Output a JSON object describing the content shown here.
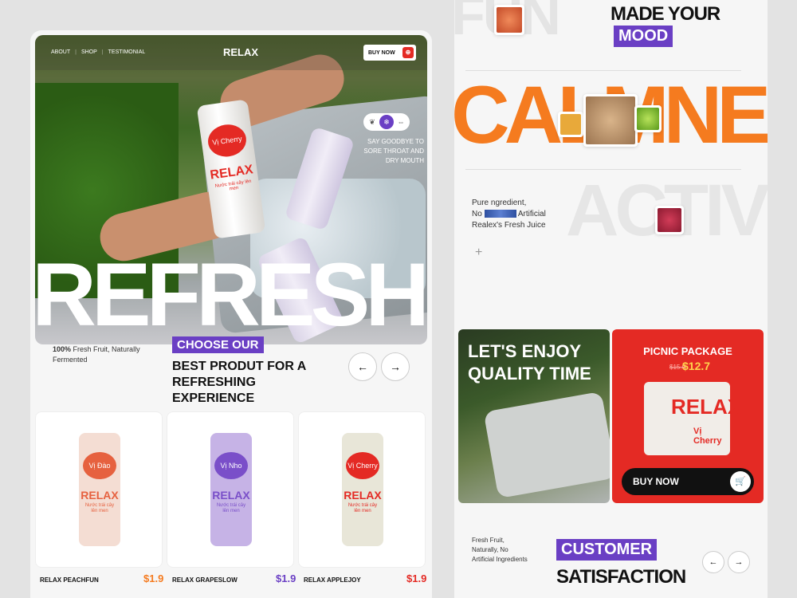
{
  "nav": {
    "links": [
      "ABOUT",
      "SHOP",
      "TESTIMONIAL"
    ],
    "logo": "RELAX",
    "buy_label": "BUY NOW"
  },
  "hero": {
    "can_flavor": "Vị Cherry",
    "can_brand": "RELAX",
    "can_sub": "Nước trái cây lên men",
    "tagline": "SAY GOODBYE TO SORE THROAT AND DRY MOUTH",
    "big_word": "REFRESHING"
  },
  "choose": {
    "pct_bold": "100%",
    "pct_text": "Fresh Fruit, Naturally Fermented",
    "tag": "CHOOSE OUR",
    "headline": "BEST PRODUT FOR A REFRESHING EXPERIENCE"
  },
  "products": [
    {
      "flavor": "Vị Đào",
      "brand": "RELAX",
      "sub": "Nước trái cây lên men",
      "name": "RELAX PEACHFUN",
      "price": "$1.9",
      "color": "#e6613f",
      "can_bg": "#f4ddd3",
      "price_color": "#f57b1f"
    },
    {
      "flavor": "Vị Nho",
      "brand": "RELAX",
      "sub": "Nước trái cây lên men",
      "name": "RELAX GRAPESLOW",
      "price": "$1.9",
      "color": "#7a4fc9",
      "can_bg": "#c6b3e6",
      "price_color": "#6a3fc4"
    },
    {
      "flavor": "Vị Cherry",
      "brand": "RELAX",
      "sub": "Nước trái cây lên men",
      "name": "RELAX APPLEJOY",
      "price": "$1.9",
      "color": "#e42a24",
      "can_bg": "#e8e6d8",
      "price_color": "#e42a24"
    }
  ],
  "right": {
    "fun": "FUN",
    "made": "MADE YOUR",
    "mood": "MOOD",
    "calm": "CALMNESS",
    "active": "ACTIVE",
    "pure_1": "Pure ngredient,",
    "pure_2a": "No",
    "pure_2b": "Artificial",
    "pure_3": "Realex's Fresh  Juice",
    "enjoy": "LET'S ENJOY QUALITY TIME",
    "picnic_title": "PICNIC PACKAGE",
    "picnic_old": "$15.0",
    "picnic_new": "$12.7",
    "pack_brand": "RELAX",
    "pack_flavor": "Vị Cherry",
    "picnic_buy": "BUY NOW",
    "fresh_1": "Fresh Fruit,",
    "fresh_2": "Naturally, No",
    "fresh_3": "Artificial Ingredients",
    "customer": "CUSTOMER",
    "satisfaction": "SATISFACTION"
  },
  "colors": {
    "accent_purple": "#6a3fc4",
    "accent_red": "#e42a24",
    "accent_orange": "#f57b1f"
  },
  "icons": [
    "leaf-icon",
    "snowflake-icon",
    "arrows-icon",
    "cart-icon",
    "arrow-left-icon",
    "arrow-right-icon",
    "plus-icon"
  ]
}
